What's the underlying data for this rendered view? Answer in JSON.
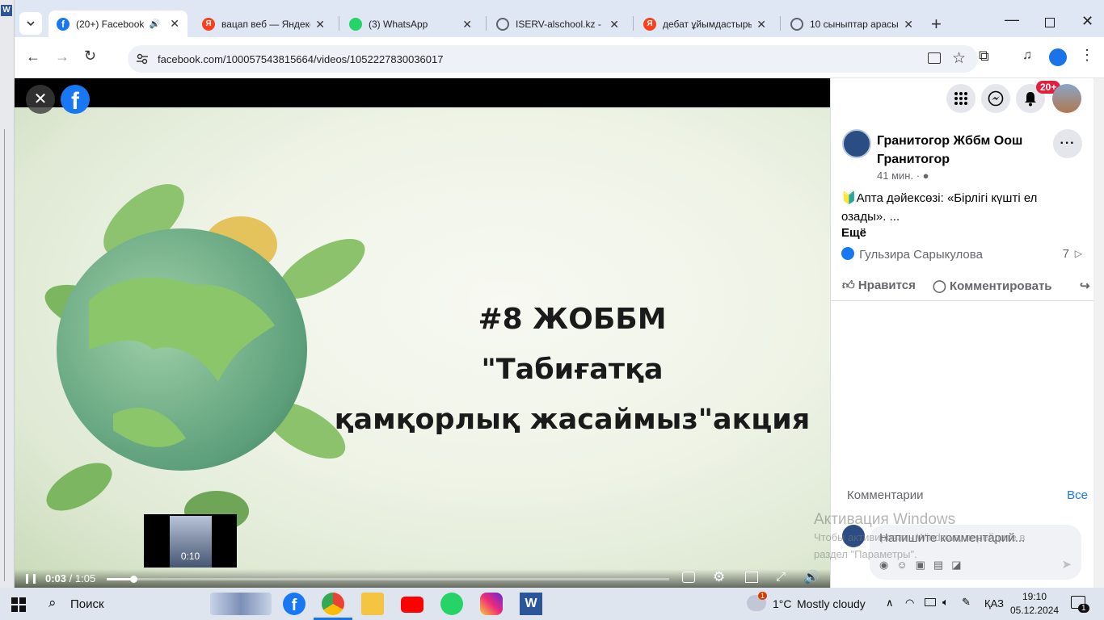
{
  "tabs": [
    {
      "title": "(20+) Facebook",
      "active": true,
      "icon": "facebook-icon",
      "color": "#1877f2"
    },
    {
      "title": "вацап веб — Яндекс",
      "icon": "yandex-icon",
      "color": "#fc3f1d"
    },
    {
      "title": "(3) WhatsApp",
      "icon": "whatsapp-icon",
      "color": "#25d366"
    },
    {
      "title": "ISERV-alschool.kz - П",
      "icon": "globe-icon",
      "color": "#5f6368"
    },
    {
      "title": "дебат ұйымдастыры",
      "icon": "yandex-icon",
      "color": "#fc3f1d"
    },
    {
      "title": "10 сыныптар арасы",
      "icon": "globe-icon",
      "color": "#5f6368"
    }
  ],
  "address": {
    "url": "facebook.com/100057543815664/videos/1052227830036017"
  },
  "video": {
    "lines": [
      "#8 ЖОББМ",
      "\"Табиғатқа",
      "қамқорлық жасаймыз\"акция"
    ],
    "current_time": "0:03",
    "separator": "/",
    "duration": "1:05",
    "progress": 0.048,
    "preview_time": "0:10"
  },
  "header": {
    "notification_badge": "20+"
  },
  "post": {
    "author": "Гранитогор Жббм Оош Гранитогор",
    "time": "41 мин.",
    "text": "🔰Апта дәйексөзі: «Бірлігі күшті ел озады». ...",
    "more": "Ещё",
    "reactor": "Гульзира Сарыкулова",
    "reaction_count": "7",
    "like_label": "Нравится",
    "comment_label": "Комментировать"
  },
  "comments": {
    "title": "Комментарии",
    "all_link": "Все",
    "placeholder": "Напишите комментарий..."
  },
  "watermark": {
    "title": "Активация Windows",
    "line1": "Чтобы активировать Windows, перейдите в",
    "line2": "раздел \"Параметры\"."
  },
  "taskbar": {
    "search_label": "Поиск",
    "weather_temp": "1°C",
    "weather_text": "Mostly cloudy",
    "weather_badge": "1",
    "language": "ҚАЗ",
    "time": "19:10",
    "date": "05.12.2024",
    "notification_count": "1"
  }
}
